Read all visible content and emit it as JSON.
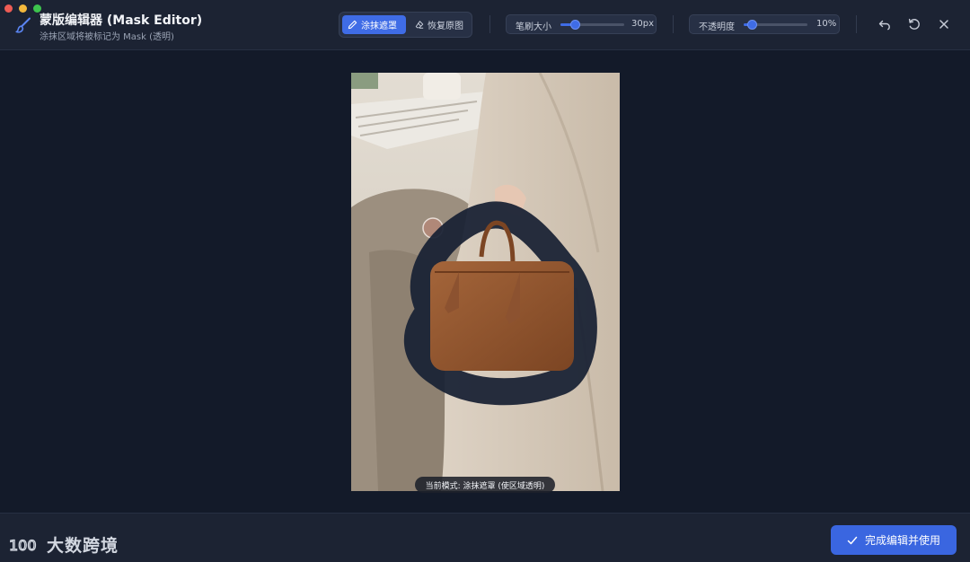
{
  "header": {
    "title": "蒙版编辑器 (Mask Editor)",
    "subtitle": "涂抹区域将被标记为 Mask (透明)"
  },
  "mode": {
    "paint_label": "涂抹遮罩",
    "restore_label": "恢复原图",
    "active": "paint"
  },
  "brush_size": {
    "label": "笔刷大小",
    "value_text": "30px",
    "fraction": 0.22
  },
  "opacity": {
    "label": "不透明度",
    "value_text": "10%",
    "fraction": 0.12
  },
  "status": {
    "current_mode_text": "当前模式: 涂抹遮罩 (使区域透明)"
  },
  "footer": {
    "done_label": "完成编辑并使用",
    "logo_text": "大数跨境",
    "logo_mark_text": "100"
  },
  "colors": {
    "accent": "#3f6ce6",
    "background": "#131a29",
    "toolbar": "#1c2333",
    "mask_stroke": "#1a2234"
  },
  "icons": {
    "app": "brush-icon",
    "paint": "pencil-icon",
    "restore": "eraser-icon",
    "undo": "undo-icon",
    "reset": "reset-icon",
    "close": "close-icon",
    "done": "check-icon"
  }
}
